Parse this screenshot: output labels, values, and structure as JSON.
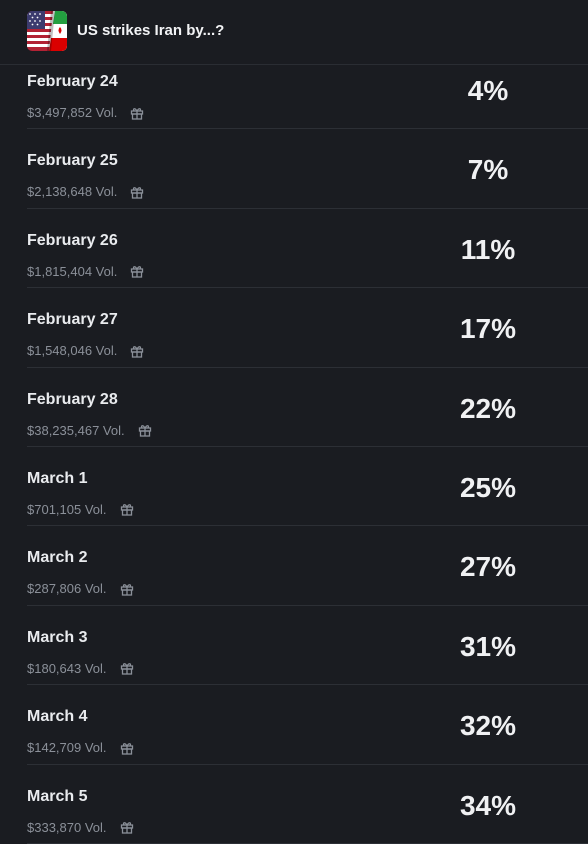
{
  "header": {
    "title": "US strikes Iran by...?",
    "icon": "us-iran-flags-icon"
  },
  "rows": [
    {
      "date": "February 24",
      "volume": "$3,497,852 Vol.",
      "percent": "4%"
    },
    {
      "date": "February 25",
      "volume": "$2,138,648 Vol.",
      "percent": "7%"
    },
    {
      "date": "February 26",
      "volume": "$1,815,404 Vol.",
      "percent": "11%"
    },
    {
      "date": "February 27",
      "volume": "$1,548,046 Vol.",
      "percent": "17%"
    },
    {
      "date": "February 28",
      "volume": "$38,235,467 Vol.",
      "percent": "22%"
    },
    {
      "date": "March 1",
      "volume": "$701,105 Vol.",
      "percent": "25%"
    },
    {
      "date": "March 2",
      "volume": "$287,806 Vol.",
      "percent": "27%"
    },
    {
      "date": "March 3",
      "volume": "$180,643 Vol.",
      "percent": "31%"
    },
    {
      "date": "March 4",
      "volume": "$142,709 Vol.",
      "percent": "32%"
    },
    {
      "date": "March 5",
      "volume": "$333,870 Vol.",
      "percent": "34%"
    }
  ],
  "colors": {
    "background": "#1a1c21",
    "divider": "#2c2f35",
    "muted_text": "#8b9099"
  }
}
